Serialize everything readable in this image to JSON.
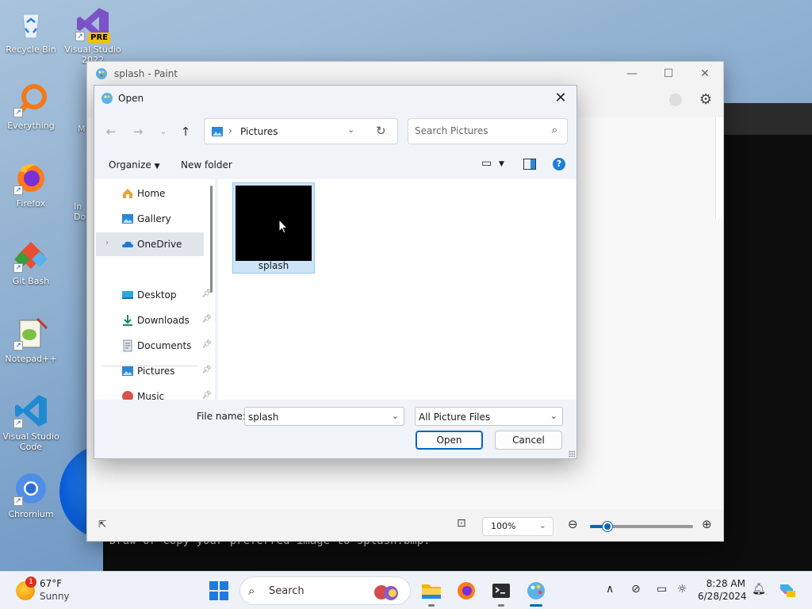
{
  "desktop": {
    "icons": [
      {
        "name": "recycle-bin",
        "label": "Recycle Bin"
      },
      {
        "name": "visual-studio-2022",
        "label": "Visual Studio 2022",
        "badge": "PRE"
      },
      {
        "name": "everything",
        "label": "Everything"
      },
      {
        "name": "firefox",
        "label": "Firefox"
      },
      {
        "name": "git-bash",
        "label": "Git Bash"
      },
      {
        "name": "notepad-plus-plus",
        "label": "Notepad++"
      },
      {
        "name": "vscode",
        "label": "Visual Studio Code"
      },
      {
        "name": "chromium",
        "label": "Chromium"
      }
    ],
    "partial_labels": {
      "m": "M",
      "in": "In",
      "do": "Do"
    }
  },
  "terminal": {
    "text": "Draw or copy your preferred image to splash.bmp."
  },
  "paint": {
    "title": "splash - Paint",
    "zoom": "100%"
  },
  "dialog": {
    "title": "Open",
    "address": "Pictures",
    "search_placeholder": "Search Pictures",
    "organize": "Organize",
    "new_folder": "New folder",
    "nav": [
      {
        "label": "Home",
        "icon": "home-icon"
      },
      {
        "label": "Gallery",
        "icon": "gallery-icon"
      },
      {
        "label": "OneDrive",
        "icon": "onedrive-icon",
        "selected": true
      },
      {
        "label": "Desktop",
        "icon": "desktop-folder-icon",
        "pinned": true
      },
      {
        "label": "Downloads",
        "icon": "downloads-icon",
        "pinned": true
      },
      {
        "label": "Documents",
        "icon": "documents-icon",
        "pinned": true
      },
      {
        "label": "Pictures",
        "icon": "pictures-icon",
        "pinned": true
      },
      {
        "label": "Music",
        "icon": "music-icon",
        "pinned": true
      }
    ],
    "files": [
      {
        "name": "splash"
      }
    ],
    "file_name_label": "File name:",
    "file_name_value": "splash",
    "file_type": "All Picture Files",
    "open_label": "Open",
    "cancel_label": "Cancel"
  },
  "taskbar": {
    "weather_temp": "67°F",
    "weather_cond": "Sunny",
    "weather_badge": "1",
    "search_label": "Search",
    "time": "8:28 AM",
    "date": "6/28/2024"
  },
  "colors": {
    "accent": "#0067c0",
    "selection": "#cce4f7"
  }
}
